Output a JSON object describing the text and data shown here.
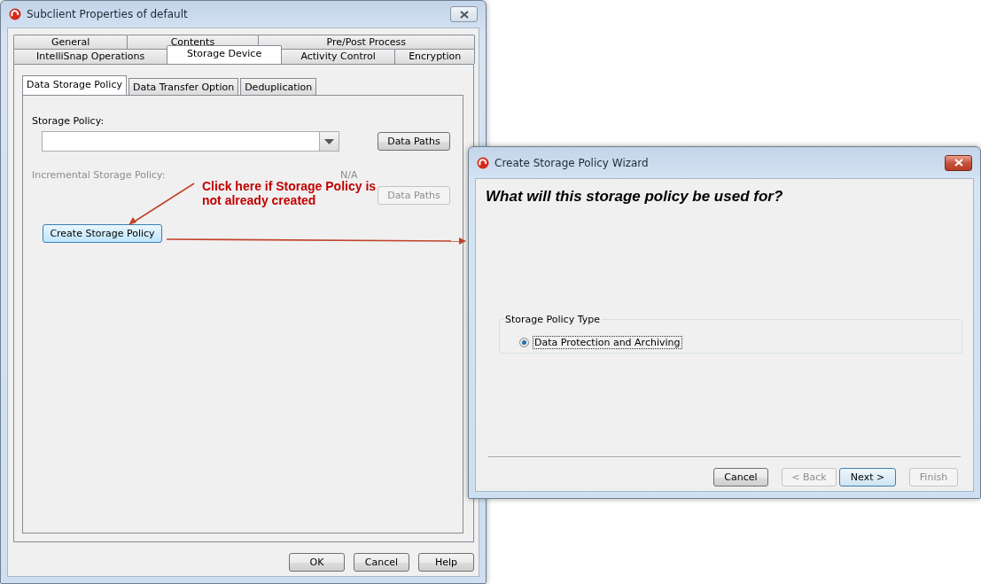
{
  "properties_dialog": {
    "title": "Subclient Properties of default",
    "tab_rows": [
      [
        {
          "label": "General",
          "selected": false
        },
        {
          "label": "Contents",
          "selected": false
        },
        {
          "label": "Pre/Post Process",
          "selected": false
        }
      ],
      [
        {
          "label": "IntelliSnap Operations",
          "selected": false
        },
        {
          "label": "Storage Device",
          "selected": true
        },
        {
          "label": "Activity Control",
          "selected": false
        },
        {
          "label": "Encryption",
          "selected": false
        }
      ]
    ],
    "subtabs": [
      {
        "label": "Data Storage Policy",
        "selected": true
      },
      {
        "label": "Data Transfer Option",
        "selected": false
      },
      {
        "label": "Deduplication",
        "selected": false
      }
    ],
    "storage_policy_label": "Storage Policy:",
    "data_paths_button": {
      "label": "Data Paths",
      "disabled": false
    },
    "incremental_label": {
      "text": "Incremental Storage Policy:",
      "disabled": true
    },
    "incremental_value": "N/A",
    "incremental_data_paths_button": {
      "label": "Data Paths",
      "disabled": true
    },
    "create_button": {
      "label": "Create Storage Policy",
      "highlighted": true
    },
    "buttons": [
      "OK",
      "Cancel",
      "Help"
    ]
  },
  "annotation": {
    "text": "Click here if Storage Policy is not already created"
  },
  "wizard": {
    "title": "Create Storage Policy Wizard",
    "question": "What will this storage policy be used for?",
    "group_title": "Storage Policy Type",
    "options": [
      {
        "label": "Data Protection and Archiving",
        "selected": true
      }
    ],
    "buttons": [
      {
        "label": "Cancel",
        "disabled": false,
        "default": false
      },
      {
        "label": "< Back",
        "disabled": true,
        "default": false
      },
      {
        "label": "Next >",
        "disabled": false,
        "default": true
      },
      {
        "label": "Finish",
        "disabled": true,
        "default": false
      }
    ]
  }
}
